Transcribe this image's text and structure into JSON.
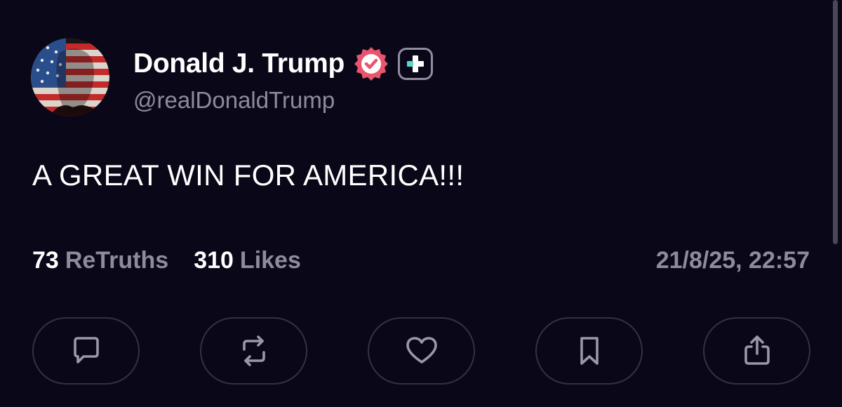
{
  "post": {
    "display_name": "Donald J. Trump",
    "handle": "@realDonaldTrump",
    "text": "A GREAT WIN FOR AMERICA!!!",
    "timestamp": "21/8/25, 22:57"
  },
  "stats": {
    "retruths_count": "73",
    "retruths_label": "ReTruths",
    "likes_count": "310",
    "likes_label": "Likes"
  },
  "badges": {
    "verified_color": "#e8556d",
    "plus_accent_color": "#5ad8c4"
  },
  "actions": [
    {
      "icon": "reply-icon"
    },
    {
      "icon": "retruth-icon"
    },
    {
      "icon": "like-heart-icon"
    },
    {
      "icon": "bookmark-icon"
    },
    {
      "icon": "share-icon"
    }
  ]
}
